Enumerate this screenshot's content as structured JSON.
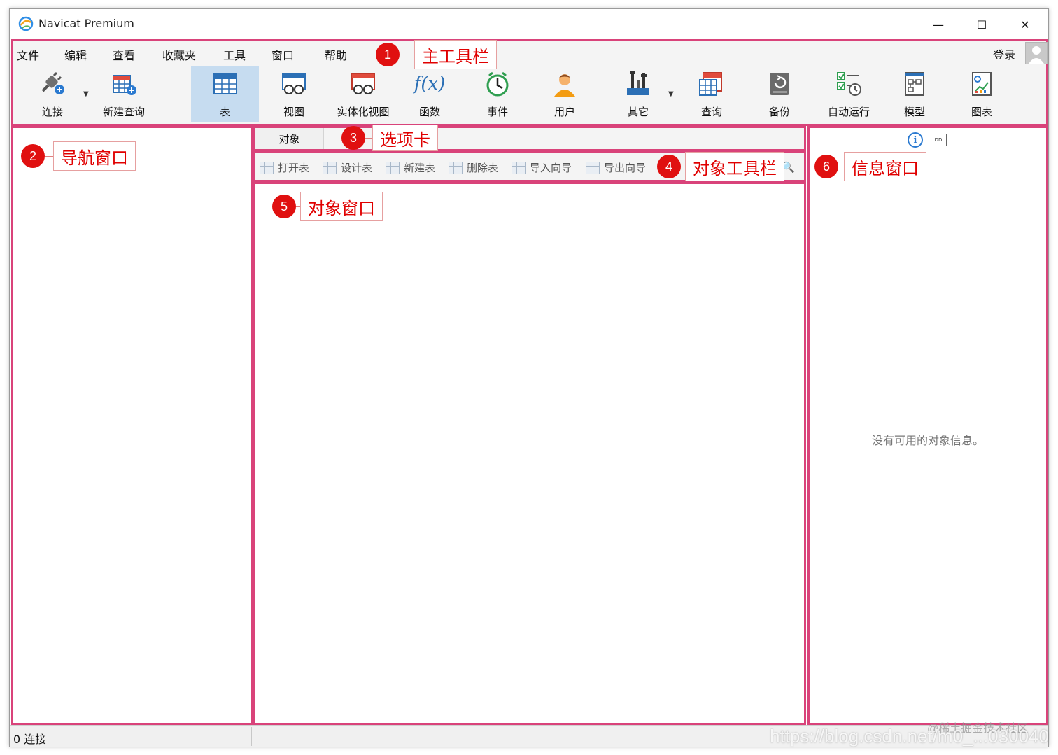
{
  "window": {
    "title": "Navicat Premium",
    "min_glyph": "—",
    "max_glyph": "☐",
    "close_glyph": "✕"
  },
  "menu": {
    "items": [
      "文件",
      "编辑",
      "查看",
      "收藏夹",
      "工具",
      "窗口",
      "帮助"
    ],
    "login": "登录"
  },
  "toolbar": {
    "tools": [
      {
        "label": "连接",
        "icon": "connection-icon"
      },
      {
        "label": "新建查询",
        "icon": "new-query-icon"
      },
      {
        "label": "表",
        "icon": "table-icon"
      },
      {
        "label": "视图",
        "icon": "view-icon"
      },
      {
        "label": "实体化视图",
        "icon": "materialized-view-icon"
      },
      {
        "label": "函数",
        "icon": "function-icon"
      },
      {
        "label": "事件",
        "icon": "event-clock-icon"
      },
      {
        "label": "用户",
        "icon": "user-icon"
      },
      {
        "label": "其它",
        "icon": "tools-icon"
      },
      {
        "label": "查询",
        "icon": "query-icon"
      },
      {
        "label": "备份",
        "icon": "backup-icon"
      },
      {
        "label": "自动运行",
        "icon": "automation-icon"
      },
      {
        "label": "模型",
        "icon": "model-icon"
      },
      {
        "label": "图表",
        "icon": "chart-icon"
      }
    ],
    "active": "表",
    "function_glyph": "f(x)"
  },
  "tabs": {
    "object_tab": "对象"
  },
  "object_toolbar": {
    "items": [
      "打开表",
      "设计表",
      "新建表",
      "删除表",
      "导入向导",
      "导出向导"
    ],
    "search_glyph": "🔍"
  },
  "info_pane": {
    "info_glyph": "i",
    "ddl_glyph": "DDL",
    "empty_message": "没有可用的对象信息。"
  },
  "status": {
    "connections": "0 连接"
  },
  "annotations": [
    {
      "number": "1",
      "label": "主工具栏"
    },
    {
      "number": "2",
      "label": "导航窗口"
    },
    {
      "number": "3",
      "label": "选项卡"
    },
    {
      "number": "4",
      "label": "对象工具栏"
    },
    {
      "number": "5",
      "label": "对象窗口"
    },
    {
      "number": "6",
      "label": "信息窗口"
    }
  ],
  "watermark": {
    "url": "https://blog.csdn.net/m0_...030040",
    "site": "@稀土掘金技术社区"
  },
  "colors": {
    "highlight_border": "#d9437a",
    "annotation_red": "#e01010",
    "active_tool_bg": "#c6dcf0",
    "info_blue": "#2b7ad0"
  }
}
